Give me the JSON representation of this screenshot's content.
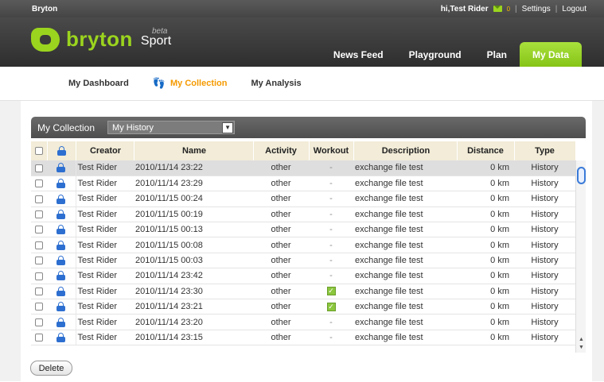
{
  "topbar": {
    "brand": "Bryton",
    "greeting": "hi,Test Rider",
    "mail_count": "0",
    "settings": "Settings",
    "logout": "Logout"
  },
  "logo": {
    "text": "bryton",
    "beta": "beta",
    "sport": "Sport"
  },
  "mainnav": [
    "News Feed",
    "Playground",
    "Plan",
    "My Data"
  ],
  "subnav": {
    "dashboard": "My Dashboard",
    "collection": "My Collection",
    "analysis": "My Analysis"
  },
  "panel": {
    "title": "My Collection",
    "select_value": "My History"
  },
  "table": {
    "headers": {
      "creator": "Creator",
      "name": "Name",
      "activity": "Activity",
      "workout": "Workout",
      "description": "Description",
      "distance": "Distance",
      "type": "Type"
    },
    "rows": [
      {
        "creator": "Test Rider",
        "name": "2010/11/14 23:22",
        "activity": "other",
        "workout": "-",
        "description": "exchange file test",
        "distance": "0 km",
        "type": "History"
      },
      {
        "creator": "Test Rider",
        "name": "2010/11/14 23:29",
        "activity": "other",
        "workout": "-",
        "description": "exchange file test",
        "distance": "0 km",
        "type": "History"
      },
      {
        "creator": "Test Rider",
        "name": "2010/11/15 00:24",
        "activity": "other",
        "workout": "-",
        "description": "exchange file test",
        "distance": "0 km",
        "type": "History"
      },
      {
        "creator": "Test Rider",
        "name": "2010/11/15 00:19",
        "activity": "other",
        "workout": "-",
        "description": "exchange file test",
        "distance": "0 km",
        "type": "History"
      },
      {
        "creator": "Test Rider",
        "name": "2010/11/15 00:13",
        "activity": "other",
        "workout": "-",
        "description": "exchange file test",
        "distance": "0 km",
        "type": "History"
      },
      {
        "creator": "Test Rider",
        "name": "2010/11/15 00:08",
        "activity": "other",
        "workout": "-",
        "description": "exchange file test",
        "distance": "0 km",
        "type": "History"
      },
      {
        "creator": "Test Rider",
        "name": "2010/11/15 00:03",
        "activity": "other",
        "workout": "-",
        "description": "exchange file test",
        "distance": "0 km",
        "type": "History"
      },
      {
        "creator": "Test Rider",
        "name": "2010/11/14 23:42",
        "activity": "other",
        "workout": "-",
        "description": "exchange file test",
        "distance": "0 km",
        "type": "History"
      },
      {
        "creator": "Test Rider",
        "name": "2010/11/14 23:30",
        "activity": "other",
        "workout": "check",
        "description": "exchange file test",
        "distance": "0 km",
        "type": "History"
      },
      {
        "creator": "Test Rider",
        "name": "2010/11/14 23:21",
        "activity": "other",
        "workout": "check",
        "description": "exchange file test",
        "distance": "0 km",
        "type": "History"
      },
      {
        "creator": "Test Rider",
        "name": "2010/11/14 23:20",
        "activity": "other",
        "workout": "-",
        "description": "exchange file test",
        "distance": "0 km",
        "type": "History"
      },
      {
        "creator": "Test Rider",
        "name": "2010/11/14 23:15",
        "activity": "other",
        "workout": "-",
        "description": "exchange file test",
        "distance": "0 km",
        "type": "History"
      }
    ]
  },
  "delete_label": "Delete",
  "colors": {
    "accent_green": "#9bd41e",
    "active_orange": "#f59a00",
    "lock_blue": "#2d6fd0"
  }
}
